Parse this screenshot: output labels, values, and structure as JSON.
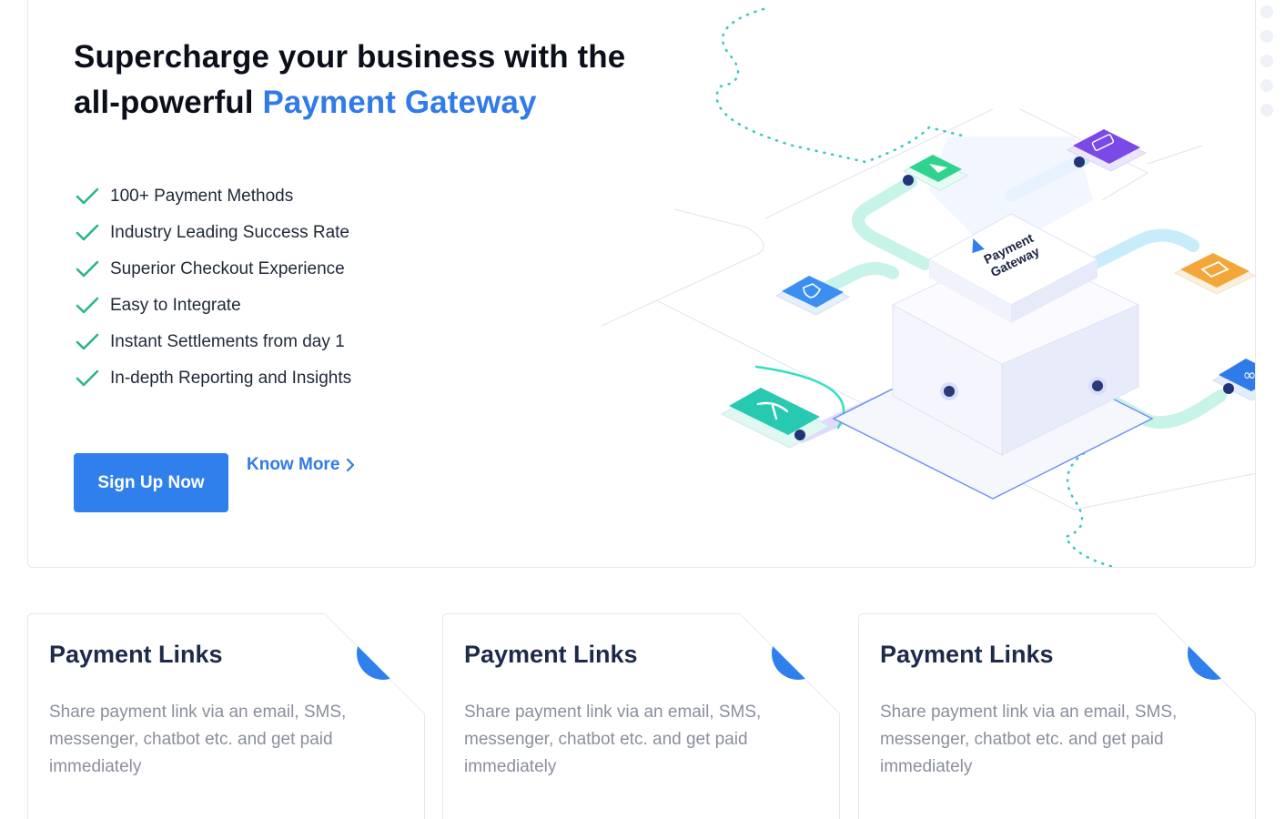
{
  "hero": {
    "title_prefix": "Supercharge your business with the all-powerful",
    "title_accent": "Payment Gateway",
    "features": [
      "100+ Payment Methods",
      "Industry Leading Success Rate",
      "Superior Checkout Experience",
      "Easy to Integrate",
      "Instant Settlements from day 1",
      "In-depth Reporting and Insights"
    ],
    "signup_label": "Sign Up Now",
    "know_more_label": "Know More",
    "illustration_label_line1": "Payment",
    "illustration_label_line2": "Gateway"
  },
  "cards": [
    {
      "title": "Payment Links",
      "description": "Share payment link via an email, SMS, messenger, chatbot etc. and get paid immediately",
      "icon": "link-arrows-icon"
    },
    {
      "title": "Payment Links",
      "description": "Share payment link via an email, SMS, messenger, chatbot etc. and get paid immediately",
      "icon": "link-arrows-icon"
    },
    {
      "title": "Payment Links",
      "description": "Share payment link via an email, SMS, messenger, chatbot etc. and get paid immediately",
      "icon": "link-arrows-icon"
    }
  ],
  "colors": {
    "accent": "#2f80ed",
    "check": "#2bb48b",
    "title": "#1e2a4a",
    "muted": "#8a8f9c"
  }
}
